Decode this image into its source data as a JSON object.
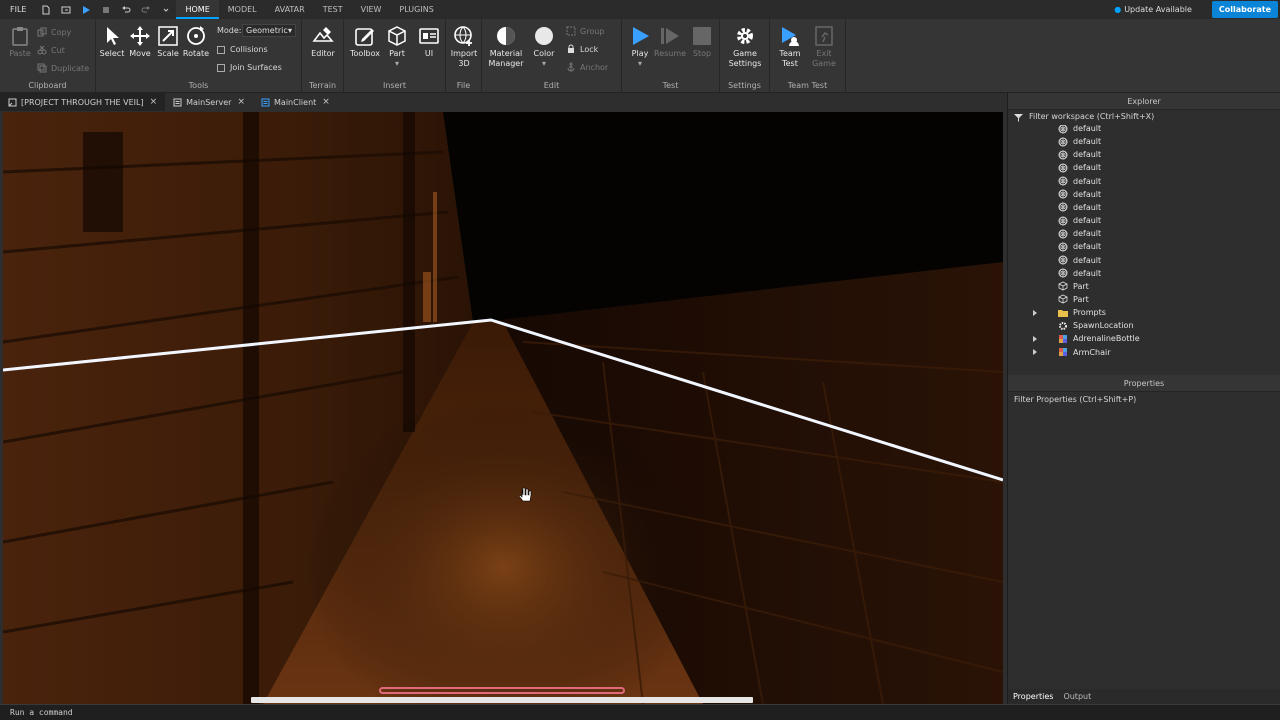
{
  "menubar": {
    "file": "FILE",
    "tabs": [
      "HOME",
      "MODEL",
      "AVATAR",
      "TEST",
      "VIEW",
      "PLUGINS"
    ],
    "active_tab": "HOME",
    "update": "Update Available",
    "collaborate": "Collaborate"
  },
  "ribbon": {
    "clipboard": {
      "paste": "Paste",
      "copy": "Copy",
      "cut": "Cut",
      "duplicate": "Duplicate",
      "label": "Clipboard"
    },
    "tools": {
      "select": "Select",
      "move": "Move",
      "scale": "Scale",
      "rotate": "Rotate",
      "mode_label": "Mode:",
      "mode_value": "Geometric",
      "collisions": "Collisions",
      "join_surfaces": "Join Surfaces",
      "label": "Tools"
    },
    "terrain": {
      "editor": "Editor",
      "label": "Terrain"
    },
    "insert": {
      "toolbox": "Toolbox",
      "part": "Part",
      "ui": "UI",
      "label": "Insert"
    },
    "file": {
      "import3d": "Import 3D",
      "label": "File"
    },
    "edit": {
      "material": "Material Manager",
      "color": "Color",
      "group": "Group",
      "lock": "Lock",
      "anchor": "Anchor",
      "label": "Edit"
    },
    "test": {
      "play": "Play",
      "resume": "Resume",
      "stop": "Stop",
      "label": "Test"
    },
    "settings": {
      "game_settings": "Game Settings",
      "label": "Settings"
    },
    "teamtest": {
      "team_test": "Team Test",
      "exit_game": "Exit Game",
      "label": "Team Test"
    }
  },
  "doctabs": [
    {
      "label": "[PROJECT THROUGH THE VEIL]",
      "active": true
    },
    {
      "label": "MainServer",
      "active": false
    },
    {
      "label": "MainClient",
      "active": false
    }
  ],
  "explorer": {
    "title": "Explorer",
    "filter": "Filter workspace (Ctrl+Shift+X)",
    "items": [
      {
        "label": "default",
        "icon": "mesh-icon"
      },
      {
        "label": "default",
        "icon": "mesh-icon"
      },
      {
        "label": "default",
        "icon": "mesh-icon"
      },
      {
        "label": "default",
        "icon": "mesh-icon"
      },
      {
        "label": "default",
        "icon": "mesh-icon"
      },
      {
        "label": "default",
        "icon": "mesh-icon"
      },
      {
        "label": "default",
        "icon": "mesh-icon"
      },
      {
        "label": "default",
        "icon": "mesh-icon"
      },
      {
        "label": "default",
        "icon": "mesh-icon"
      },
      {
        "label": "default",
        "icon": "mesh-icon"
      },
      {
        "label": "default",
        "icon": "mesh-icon"
      },
      {
        "label": "default",
        "icon": "mesh-icon"
      },
      {
        "label": "Part",
        "icon": "part-icon"
      },
      {
        "label": "Part",
        "icon": "part-icon"
      },
      {
        "label": "Prompts",
        "icon": "folder-icon"
      },
      {
        "label": "SpawnLocation",
        "icon": "spawn-icon"
      },
      {
        "label": "AdrenalineBottle",
        "icon": "model-icon"
      },
      {
        "label": "ArmChair",
        "icon": "model-icon"
      }
    ]
  },
  "properties": {
    "title": "Properties",
    "filter": "Filter Properties (Ctrl+Shift+P)"
  },
  "bottomtabs": [
    "Properties",
    "Output"
  ],
  "command": "Run a command"
}
